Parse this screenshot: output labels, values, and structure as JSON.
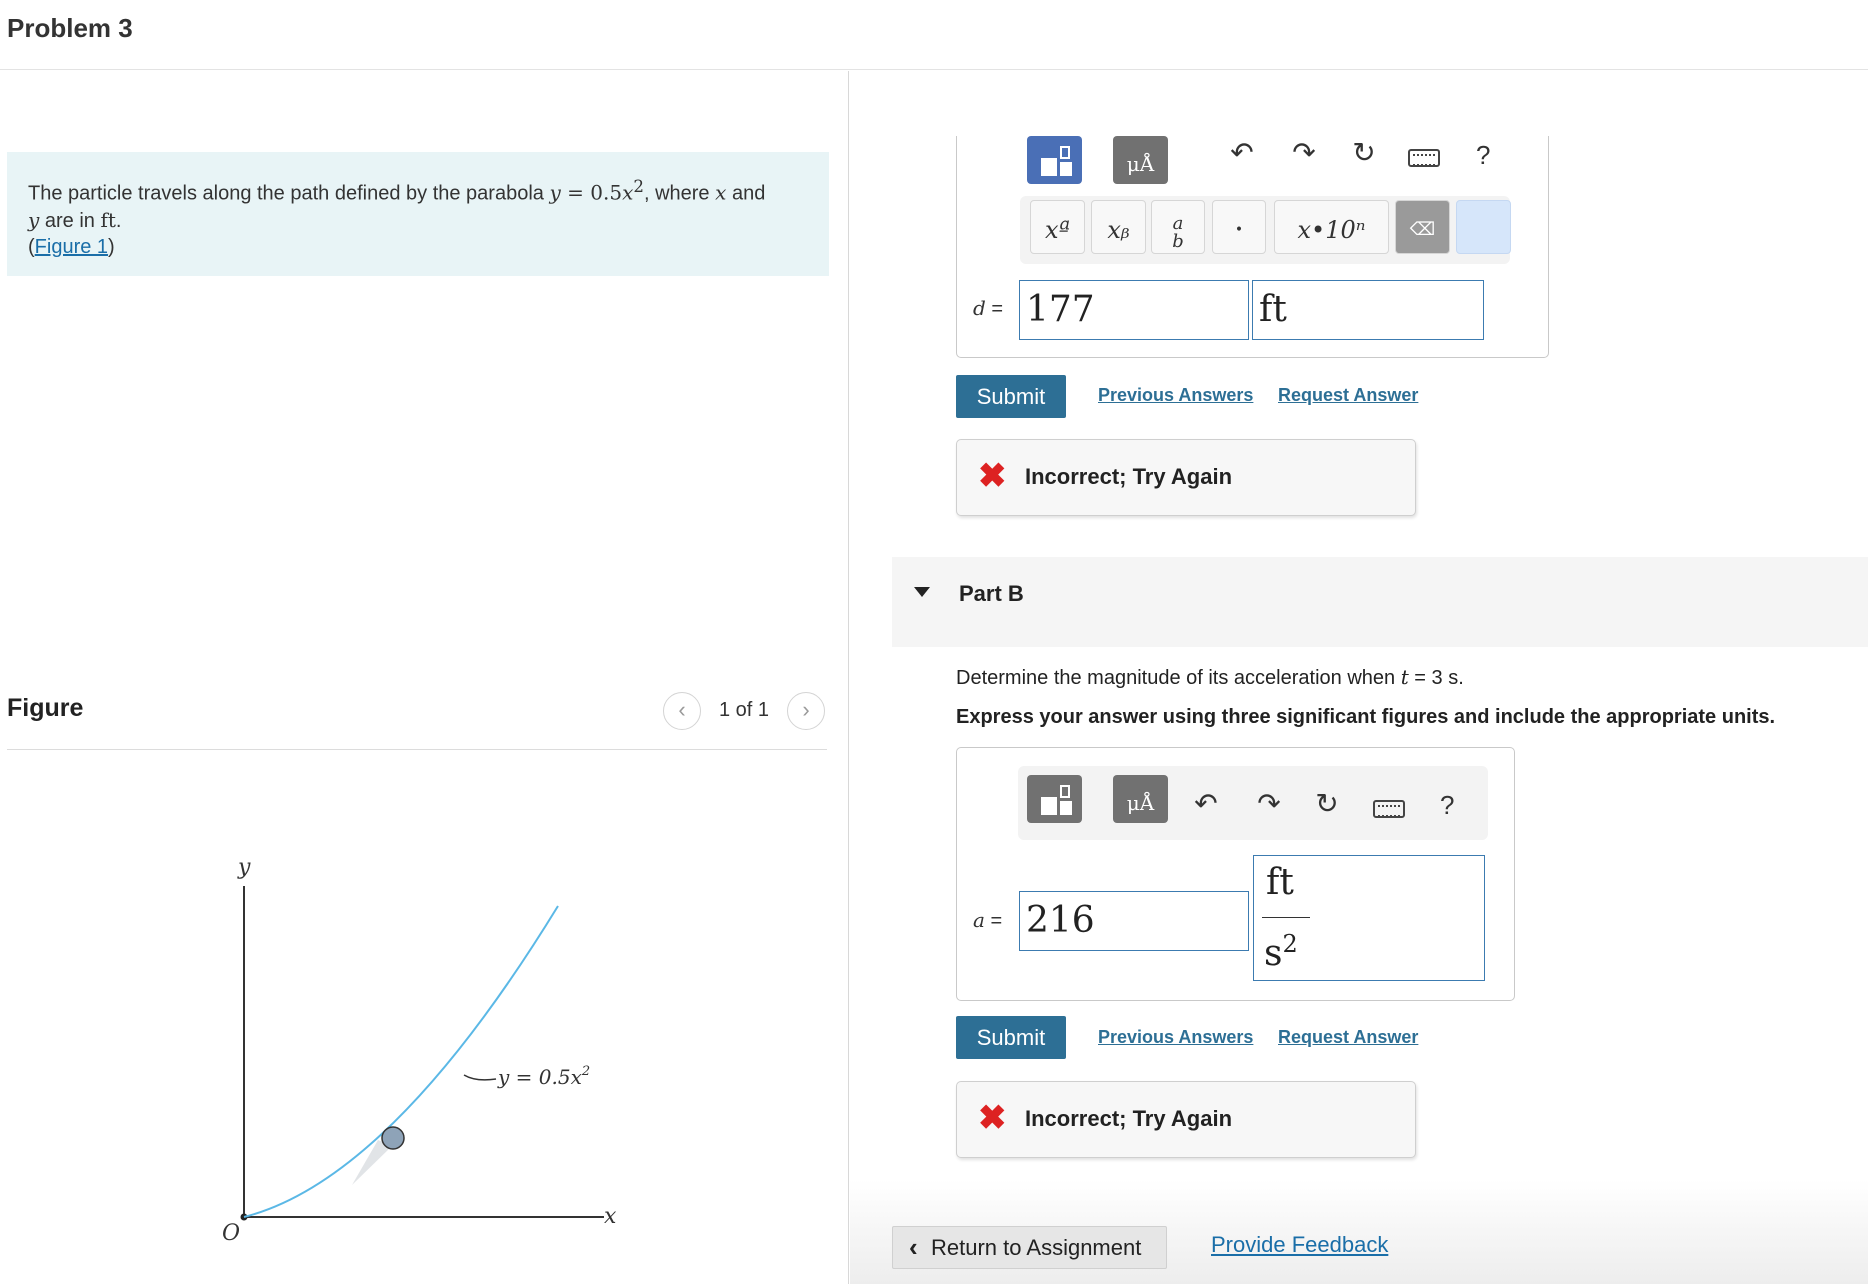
{
  "header": {
    "title": "Problem 3"
  },
  "intro": {
    "text_1": "The particle travels along the path defined by the parabola ",
    "eq_lhs": "y",
    "eq_mid": " = 0.5",
    "eq_var": "x",
    "eq_exp": "2",
    "text_2": ", where ",
    "var_x": "x",
    "text_3": " and",
    "var_y": "y",
    "text_4": " are in ",
    "unit": "ft",
    "text_5": ".",
    "link_open": "(",
    "link": "Figure 1",
    "link_close": ")"
  },
  "figure_panel": {
    "label": "Figure",
    "counter": "1 of 1",
    "prev_icon": "chevron-left-icon",
    "next_icon": "chevron-right-icon",
    "axis_y": "y",
    "axis_x": "x",
    "origin": "O",
    "curve_label": "y = 0.5x",
    "curve_label_exp": "2"
  },
  "toolbar": {
    "units_label": "μÅ",
    "undo_icon": "undo-icon",
    "redo_icon": "redo-icon",
    "reset_icon": "reset-icon",
    "keyboard_icon": "keyboard-icon",
    "help": "?"
  },
  "keys": {
    "superscript": "xª",
    "subscript": "xᵦ",
    "fraction_num": "a",
    "fraction_den": "b",
    "dot": "•",
    "sci": "x•10ⁿ",
    "delete": "⌫"
  },
  "part_a": {
    "var": "d",
    "eq": " =",
    "value": "177",
    "unit": "ft",
    "submit": "Submit",
    "previous": "Previous Answers",
    "request": "Request Answer",
    "feedback": "Incorrect; Try Again"
  },
  "part_b": {
    "title": "Part B",
    "question_1": "Determine the magnitude of its acceleration when ",
    "question_var": "t",
    "question_2": " = 3 s.",
    "instruction": "Express your answer using three significant figures and include the appropriate units.",
    "var": "a",
    "eq": " =",
    "value": "216",
    "unit_num": "ft",
    "unit_den": "s",
    "unit_den_exp": "2",
    "submit": "Submit",
    "previous": "Previous Answers",
    "request": "Request Answer",
    "feedback": "Incorrect; Try Again"
  },
  "footer": {
    "return": "Return to Assignment",
    "provide_feedback": "Provide Feedback"
  },
  "colors": {
    "accent": "#2d6f95",
    "intro_bg": "#e8f4f6",
    "error": "#dd2222",
    "curve": "#5bb8e6"
  }
}
